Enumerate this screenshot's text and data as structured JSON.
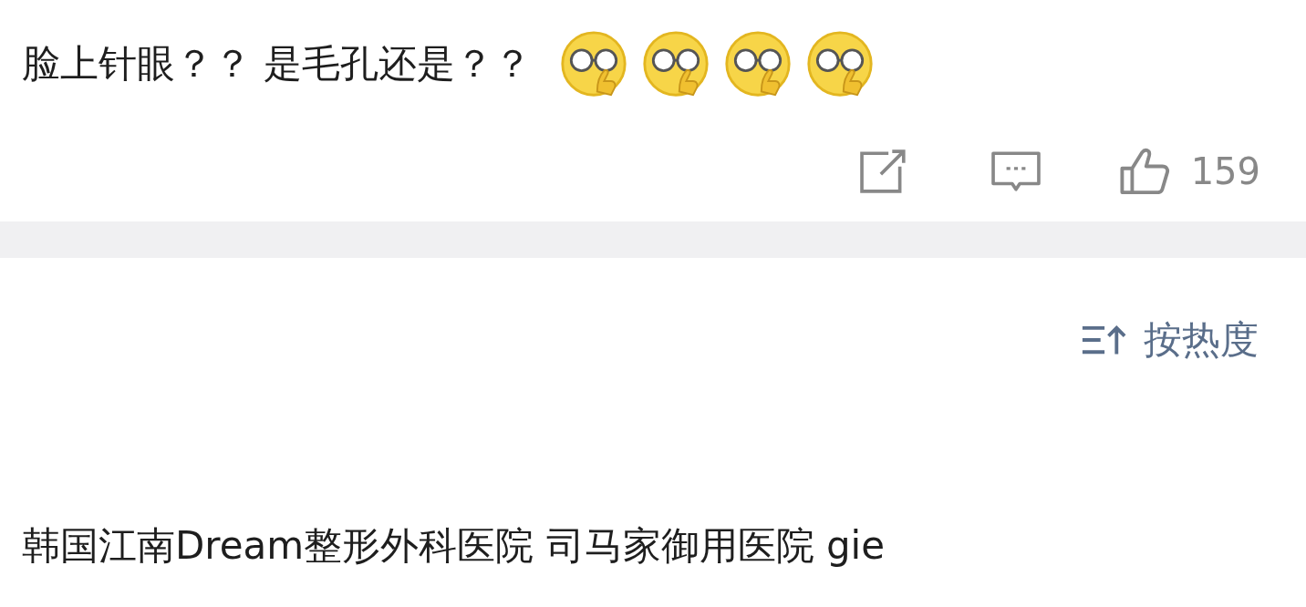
{
  "comment": {
    "text": "脸上针眼？？ 是毛孔还是？？",
    "emojis": [
      {
        "kind": "glasses"
      },
      {
        "kind": "glasses"
      },
      {
        "kind": "glasses"
      },
      {
        "kind": "glasses"
      }
    ],
    "likes": "159"
  },
  "sort": {
    "label": "按热度"
  },
  "next_comment": {
    "text": "韩国江南Dream整形外科医院 司马家御用医院 gie"
  }
}
